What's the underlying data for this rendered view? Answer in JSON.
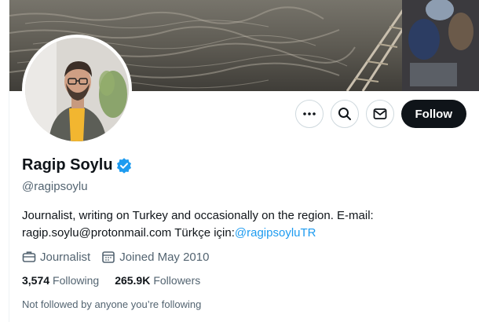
{
  "profile": {
    "name": "Ragip Soylu",
    "handle": "@ragipsoylu",
    "bio_text": "Journalist, writing on Turkey and occasionally on the region. E-mail: ragip.soylu@protonmail.com Türkçe için:",
    "bio_link": "@ragipsoyluTR",
    "profession": "Journalist",
    "joined": "Joined May 2010",
    "following_count": "3,574",
    "following_label": "Following",
    "followers_count": "265.9K",
    "followers_label": "Followers",
    "followed_by_note": "Not followed by anyone you’re following"
  },
  "actions": {
    "more_icon": "more-icon",
    "search_icon": "search-icon",
    "message_icon": "mail-icon",
    "follow_label": "Follow"
  },
  "colors": {
    "accent": "#1d9bf0",
    "verified": "#1d9bf0",
    "follow_bg": "#0f1419",
    "secondary_text": "#536471"
  }
}
